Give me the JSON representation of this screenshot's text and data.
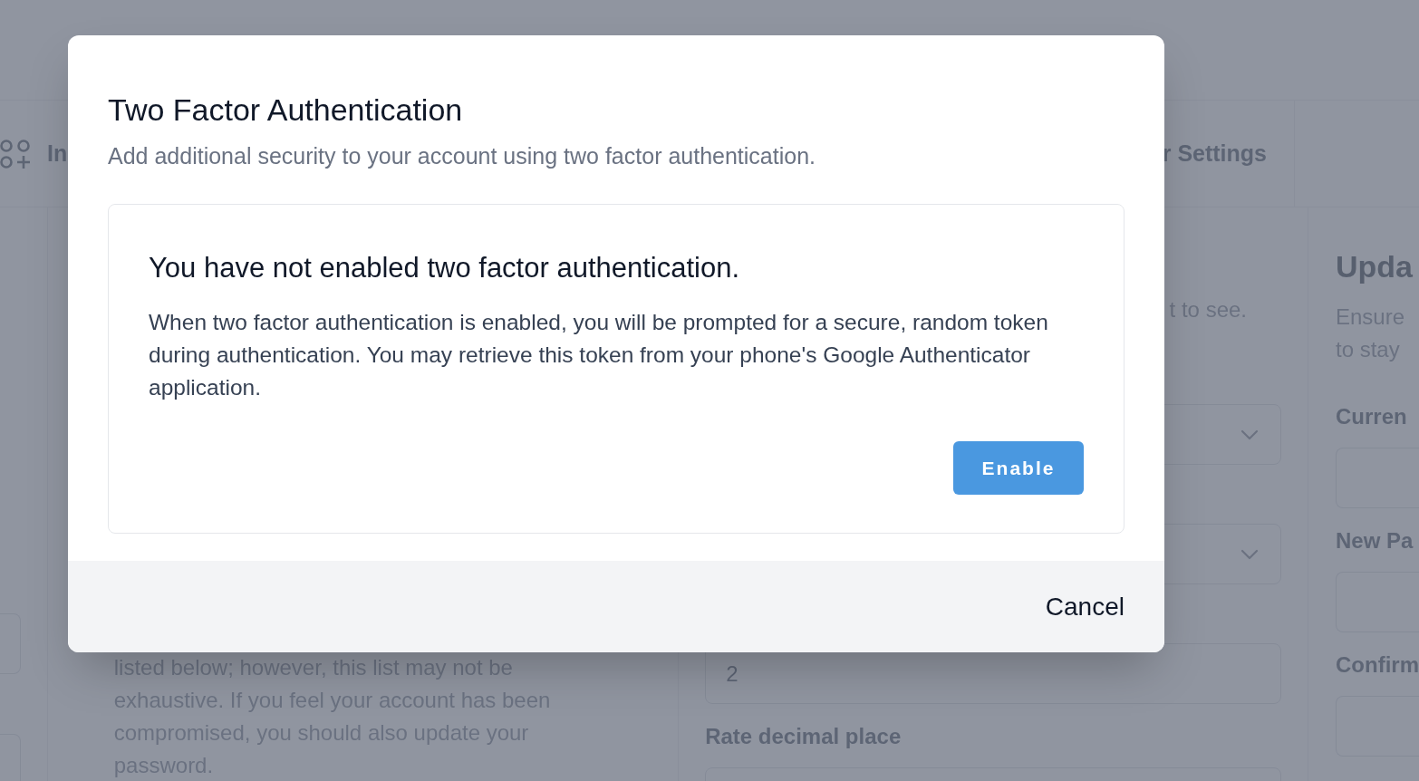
{
  "background": {
    "tabs": [
      {
        "label": "In"
      },
      {
        "label": "r Settings"
      }
    ],
    "left_text": "listed below; however, this list may not be exhaustive. If you feel your account has been compromised, you should also update your password.",
    "middle": {
      "hint": "t to see.",
      "value_field": "2",
      "label": "Rate decimal place"
    },
    "right": {
      "title": "Upda",
      "description": [
        "Ensure",
        "to stay"
      ],
      "labels": [
        "Curren",
        "New Pa",
        "Confirm"
      ]
    }
  },
  "dialog": {
    "title": "Two Factor Authentication",
    "subtitle": "Add additional security to your account using two factor authentication.",
    "card": {
      "heading": "You have not enabled two factor authentication.",
      "body": "When two factor authentication is enabled, you will be prompted for a secure, random token during authentication. You may retrieve this token from your phone's Google Authenticator application.",
      "button": "Enable"
    },
    "footer_button": "Cancel"
  }
}
